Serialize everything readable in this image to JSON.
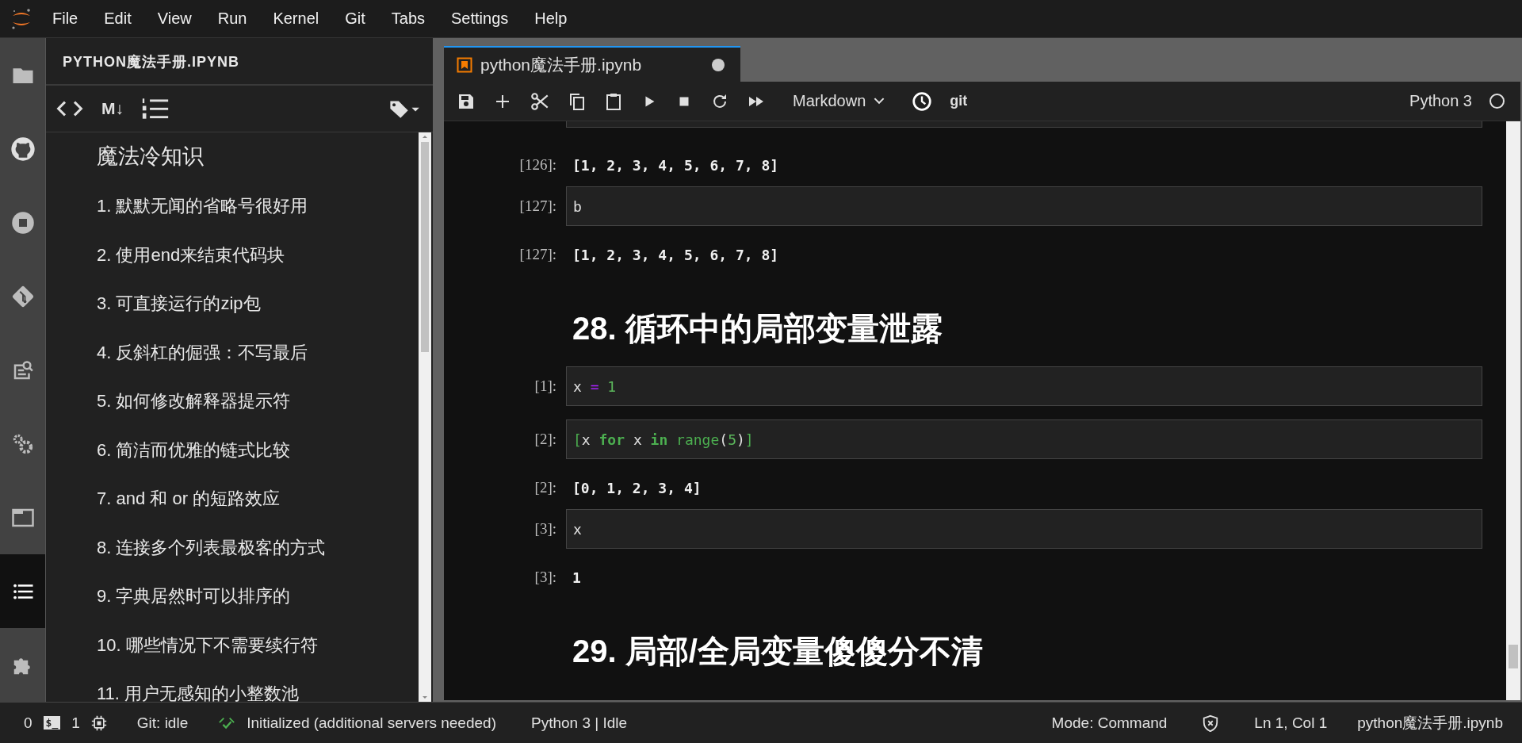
{
  "menu_bar": {
    "items": [
      "File",
      "Edit",
      "View",
      "Run",
      "Kernel",
      "Git",
      "Tabs",
      "Settings",
      "Help"
    ]
  },
  "activity_bar": {
    "items": [
      {
        "kind": "folder",
        "selected": false
      },
      {
        "kind": "github",
        "selected": false
      },
      {
        "kind": "stop",
        "selected": false
      },
      {
        "kind": "git",
        "selected": false
      },
      {
        "kind": "inspector",
        "selected": false
      },
      {
        "kind": "gears",
        "selected": false
      },
      {
        "kind": "tabs",
        "selected": false
      },
      {
        "kind": "toc",
        "selected": true
      },
      {
        "kind": "puzzle",
        "selected": false
      }
    ]
  },
  "sidebar": {
    "title": "PYTHON魔法手册.IPYNB",
    "markdown_glyph": "M↓",
    "items": [
      {
        "label": "魔法冷知识",
        "kind": "title"
      },
      {
        "label": "1. 默默无闻的省略号很好用",
        "kind": "entry"
      },
      {
        "label": "2. 使用end来结束代码块",
        "kind": "entry"
      },
      {
        "label": "3. 可直接运行的zip包",
        "kind": "entry"
      },
      {
        "label": "4. 反斜杠的倔强：不写最后",
        "kind": "entry"
      },
      {
        "label": "5. 如何修改解释器提示符",
        "kind": "entry"
      },
      {
        "label": "6. 简洁而优雅的链式比较",
        "kind": "entry"
      },
      {
        "label": "7. and 和 or 的短路效应",
        "kind": "entry"
      },
      {
        "label": "8. 连接多个列表最极客的方式",
        "kind": "entry"
      },
      {
        "label": "9. 字典居然时可以排序的",
        "kind": "entry"
      },
      {
        "label": "10. 哪些情况下不需要续行符",
        "kind": "entry"
      },
      {
        "label": "11. 用户无感知的小整数池",
        "kind": "entry"
      }
    ]
  },
  "tab": {
    "label": "python魔法手册.ipynb",
    "selected": true,
    "dirty": true
  },
  "toolbar": {
    "cell_type": "Markdown",
    "git_label": "git",
    "kernel_name": "Python 3",
    "kernel_busy": false
  },
  "cells": [
    {
      "kind": "input_edge"
    },
    {
      "kind": "output",
      "prompt": "[126]:",
      "text": "[1, 2, 3, 4, 5, 6, 7, 8]"
    },
    {
      "kind": "input",
      "prompt": "[127]:",
      "tokens": [
        {
          "text": "b",
          "kind": "name"
        }
      ]
    },
    {
      "kind": "output",
      "prompt": "[127]:",
      "text": "[1, 2, 3, 4, 5, 6, 7, 8]"
    },
    {
      "kind": "heading",
      "text": "28. 循环中的局部变量泄露"
    },
    {
      "kind": "input",
      "prompt": "[1]:",
      "tokens": [
        {
          "text": "x ",
          "kind": "name"
        },
        {
          "text": "=",
          "kind": "operator"
        },
        {
          "text": " 1",
          "kind": "number"
        }
      ]
    },
    {
      "kind": "input",
      "prompt": "[2]:",
      "tokens": [
        {
          "text": "[",
          "kind": "bracket"
        },
        {
          "text": "x ",
          "kind": "name"
        },
        {
          "text": "for",
          "kind": "keyword"
        },
        {
          "text": " x ",
          "kind": "name"
        },
        {
          "text": "in",
          "kind": "keyword"
        },
        {
          "text": " range",
          "kind": "builtin"
        },
        {
          "text": "(",
          "kind": "name"
        },
        {
          "text": "5",
          "kind": "number"
        },
        {
          "text": ")",
          "kind": "name"
        },
        {
          "text": "]",
          "kind": "bracket"
        }
      ]
    },
    {
      "kind": "output",
      "prompt": "[2]:",
      "text": "[0, 1, 2, 3, 4]"
    },
    {
      "kind": "input",
      "prompt": "[3]:",
      "tokens": [
        {
          "text": "x",
          "kind": "name"
        }
      ]
    },
    {
      "kind": "output",
      "prompt": "[3]:",
      "text": "1"
    },
    {
      "kind": "heading",
      "text": "29. 局部/全局变量傻傻分不清"
    }
  ],
  "status_bar": {
    "terminals": "0",
    "terminal_glyph": "$_",
    "kernels": "1",
    "git": "Git: idle",
    "lsp": "Initialized (additional servers needed)",
    "kernel": "Python 3 | Idle",
    "mode": "Mode: Command",
    "position": "Ln 1, Col 1",
    "file": "python魔法手册.ipynb"
  }
}
